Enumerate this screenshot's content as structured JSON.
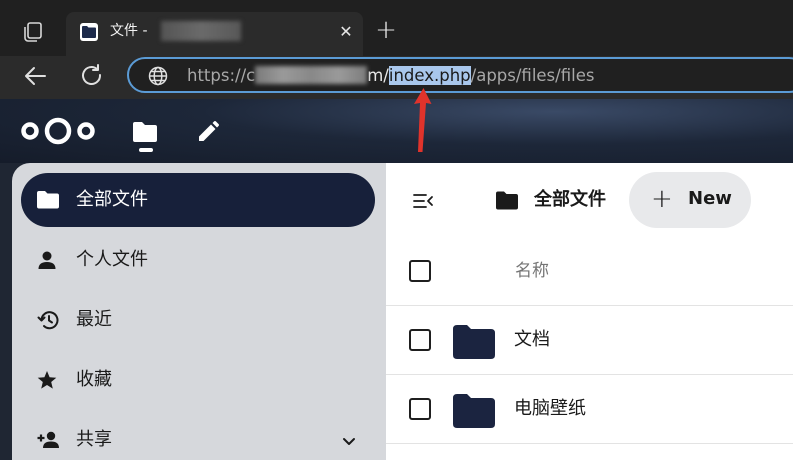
{
  "browser": {
    "tab_title": "文件 - ",
    "url_prefix": "https://c",
    "url_after_blur": "m/",
    "url_highlight": "index.php",
    "url_suffix": "/apps/files/files",
    "icons": {
      "collections": "collections-icon",
      "favicon": "nextcloud-folder-icon",
      "close": "close-icon",
      "new_tab": "plus-icon",
      "back": "back-arrow-icon",
      "refresh": "refresh-icon",
      "site_info": "globe-icon"
    },
    "new_tab_glyph": "+",
    "close_glyph": "✕"
  },
  "header": {
    "apps": [
      {
        "name": "files",
        "icon": "folder-icon",
        "active": true
      },
      {
        "name": "edit",
        "icon": "pencil-icon",
        "active": false
      }
    ]
  },
  "sidebar": {
    "items": [
      {
        "label": "全部文件",
        "icon": "folder-icon",
        "active": true
      },
      {
        "label": "个人文件",
        "icon": "user-icon",
        "active": false
      },
      {
        "label": "最近",
        "icon": "history-icon",
        "active": false
      },
      {
        "label": "收藏",
        "icon": "star-icon",
        "active": false
      },
      {
        "label": "共享",
        "icon": "share-user-icon",
        "active": false,
        "expandable": true
      }
    ]
  },
  "main": {
    "breadcrumb": "全部文件",
    "new_button": {
      "plus": "+",
      "label": "New"
    },
    "column_header": "名称",
    "files": [
      {
        "name": "文档",
        "type": "folder"
      },
      {
        "name": "电脑壁纸",
        "type": "folder"
      }
    ]
  },
  "colors": {
    "accent_dark": "#17203a",
    "url_highlight": "#a9c7ec",
    "annotation_arrow": "#e0332b",
    "address_focus": "#5b9bd5"
  }
}
